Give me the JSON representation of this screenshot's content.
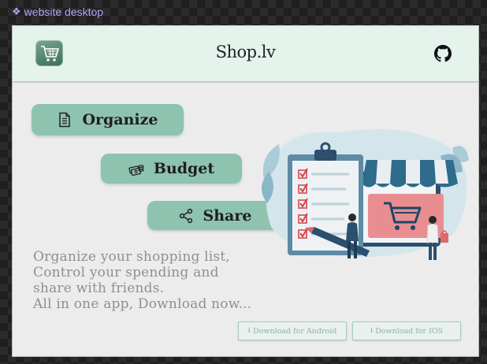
{
  "frame_label": "website desktop",
  "header": {
    "brand": "Shop.lv"
  },
  "features": [
    {
      "label": "Organize",
      "icon": "document-icon"
    },
    {
      "label": "Budget",
      "icon": "money-stack-icon"
    },
    {
      "label": "Share",
      "icon": "share-icon"
    }
  ],
  "tagline": [
    "Organize your shopping list,",
    "Control your spending and",
    "share with friends.",
    "All in one app, Download now..."
  ],
  "downloads": {
    "android": "Download for Android",
    "ios": "Download for IOS"
  },
  "colors": {
    "header_bg": "#e4f3ec",
    "accent": "#8ec3af",
    "text_muted": "#8f8f8f"
  }
}
